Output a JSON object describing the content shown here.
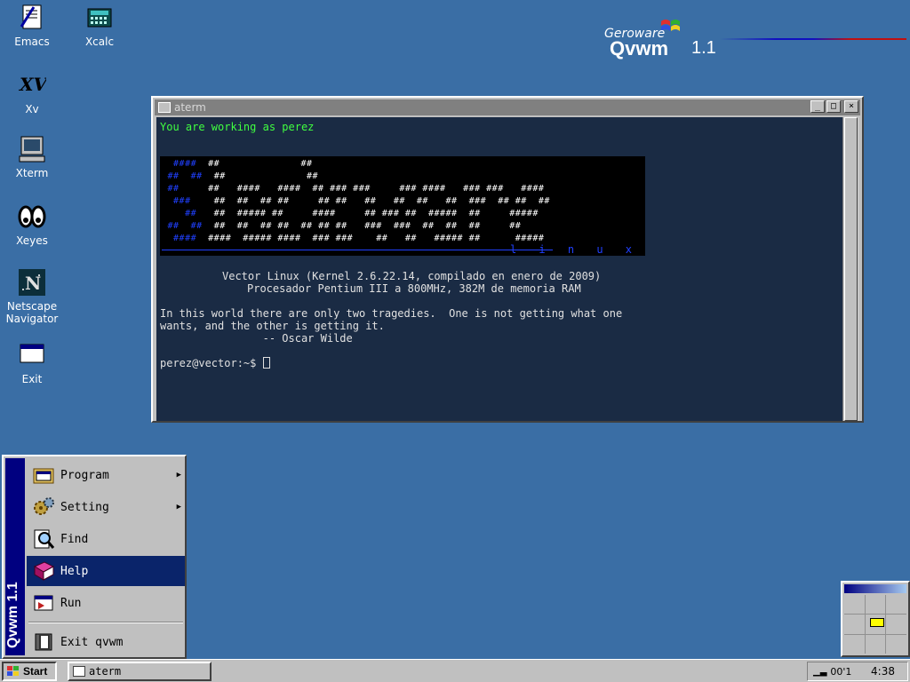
{
  "desktop": {
    "icons": [
      {
        "label": "Emacs",
        "icon": "emacs-icon"
      },
      {
        "label": "Xcalc",
        "icon": "calculator-icon"
      },
      {
        "label": "Xv",
        "icon": "xv-icon"
      },
      {
        "label": "Xterm",
        "icon": "terminal-icon"
      },
      {
        "label": "Xeyes",
        "icon": "eyes-icon"
      },
      {
        "label": "Netscape\nNavigator",
        "icon": "netscape-icon"
      },
      {
        "label": "Exit",
        "icon": "exit-window-icon"
      }
    ]
  },
  "logo": {
    "vendor": "Geroware",
    "product": "Qvwm",
    "version": "1.1"
  },
  "window": {
    "title": "aterm",
    "buttons": {
      "minimize": "_",
      "maximize": "□",
      "close": "×"
    },
    "terminal": {
      "greeting": "You are working as perez",
      "banner_tag": "l i n u x",
      "info_line1": "Vector Linux (Kernel 2.6.22.14, compilado en enero de 2009)",
      "info_line2": "Procesador Pentium III a 800MHz, 382M de memoria RAM",
      "quote_line1": "In this world there are only two tragedies.  One is not getting what one",
      "quote_line2": "wants, and the other is getting it.",
      "quote_line3": "                -- Oscar Wilde",
      "prompt": "perez@vector:~$ "
    }
  },
  "start_menu": {
    "side_title": "Qvwm 1.1",
    "items": [
      {
        "label": "Program",
        "has_submenu": true,
        "icon": "program-folder-icon"
      },
      {
        "label": "Setting",
        "has_submenu": true,
        "icon": "settings-gears-icon"
      },
      {
        "label": "Find",
        "has_submenu": false,
        "icon": "magnifier-icon"
      },
      {
        "label": "Help",
        "has_submenu": false,
        "icon": "help-book-icon"
      },
      {
        "label": "Run",
        "has_submenu": false,
        "icon": "run-icon"
      },
      {
        "label": "Exit qvwm",
        "has_submenu": false,
        "icon": "exit-qvwm-icon"
      }
    ],
    "submenu_arrow": "▶",
    "active_item": "Help"
  },
  "taskbar": {
    "start_label": "Start",
    "tasks": [
      {
        "label": "aterm"
      }
    ],
    "tray_indicator": "00'1",
    "clock": "4:38"
  },
  "colors": {
    "desktop": "#3a6ea5",
    "terminal_bg": "#1a2b44",
    "menu_highlight": "#0a246a",
    "menu_sidebar": "#000080"
  }
}
